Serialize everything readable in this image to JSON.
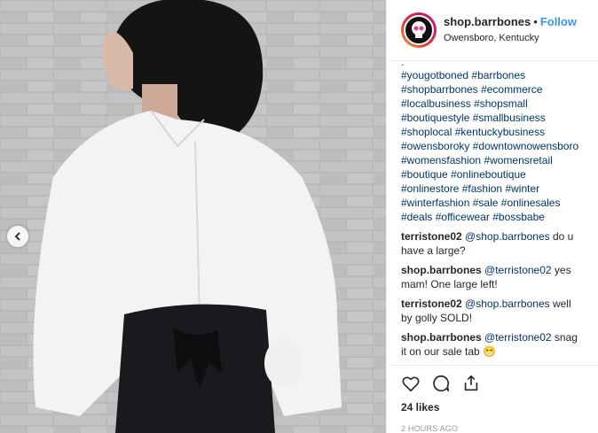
{
  "header": {
    "username": "shop.barrbones",
    "separator": "•",
    "follow_label": "Follow",
    "location": "Owensboro, Kentucky"
  },
  "caption": {
    "ellipsis": ".",
    "lines": [
      [
        "#yougotboned",
        "#barrbones"
      ],
      [
        "#shopbarrbones",
        "#ecommerce"
      ],
      [
        "#localbusiness",
        "#shopsmall"
      ],
      [
        "#boutiquestyle",
        "#smallbusiness"
      ],
      [
        "#shoplocal",
        "#kentuckybusiness"
      ],
      [
        "#owensboroky",
        "#downtownowensboro"
      ],
      [
        "#womensfashion",
        "#womensretail"
      ],
      [
        "#boutique",
        "#onlineboutique"
      ],
      [
        "#onlinestore",
        "#fashion",
        "#winter"
      ],
      [
        "#winterfashion",
        "#sale",
        "#onlinesales"
      ],
      [
        "#deals",
        "#officewear",
        "#bossbabe"
      ]
    ]
  },
  "comments": [
    {
      "user": "terristone02",
      "mention": "@shop.barrbones",
      "text": " do u have a large?"
    },
    {
      "user": "shop.barrbones",
      "mention": "@terristone02",
      "text": " yes mam! One large left!"
    },
    {
      "user": "terristone02",
      "mention": "@shop.barrbones",
      "text": " well by golly SOLD!"
    },
    {
      "user": "shop.barrbones",
      "mention": "@terristone02",
      "text": " snag it on our sale tab 😁"
    }
  ],
  "actions": {
    "likes": "24 likes",
    "timestamp": "2 HOURS AGO"
  },
  "colors": {
    "link": "#003569",
    "follow": "#3897f0",
    "text": "#262626",
    "muted": "#999999"
  }
}
